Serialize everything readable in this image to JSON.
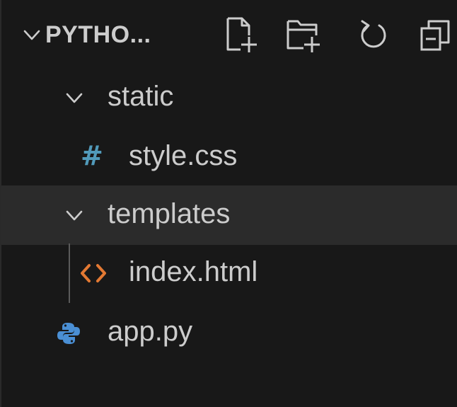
{
  "explorer": {
    "title": "PYTHO...",
    "actions": [
      {
        "name": "new-file-icon"
      },
      {
        "name": "new-folder-icon"
      },
      {
        "name": "refresh-icon"
      },
      {
        "name": "collapse-all-icon"
      }
    ],
    "tree": {
      "static": {
        "label": "static",
        "icon": "chevron-down-icon"
      },
      "style_css": {
        "label": "style.css",
        "icon": "#"
      },
      "templates": {
        "label": "templates",
        "icon": "chevron-down-icon"
      },
      "index_html": {
        "label": "index.html",
        "icon": "html-icon"
      },
      "app_py": {
        "label": "app.py",
        "icon": "python-icon"
      }
    }
  },
  "colors": {
    "background": "#181818",
    "selected_row": "#2b2b2b",
    "text": "#cccccc",
    "css_icon": "#519aba",
    "html_icon": "#e37933",
    "python_icon": "#4a8fd4"
  }
}
